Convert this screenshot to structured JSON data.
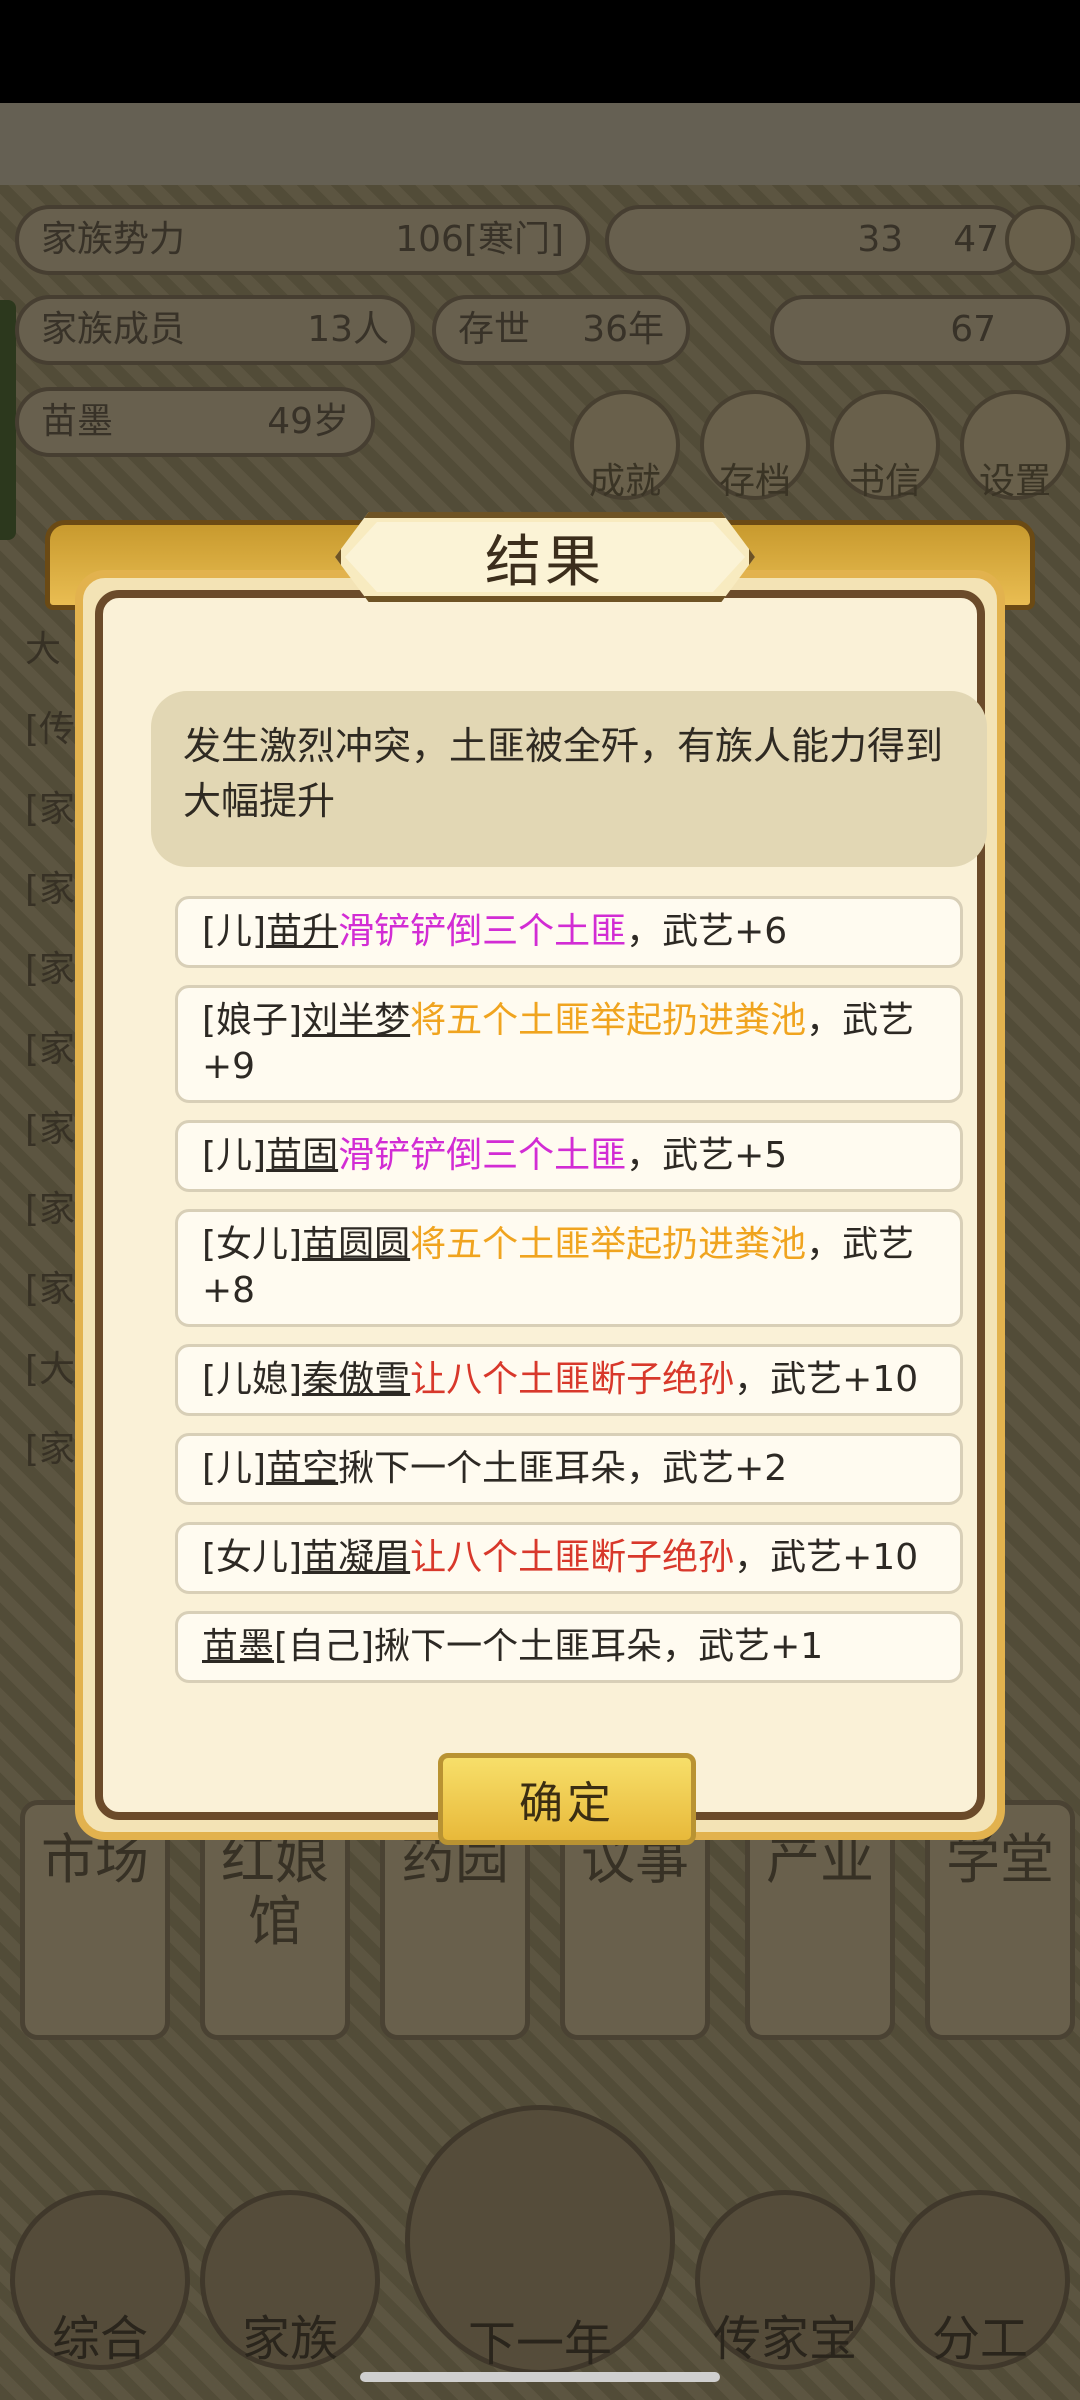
{
  "header": {
    "family_power_label": "家族势力",
    "family_power_value": "106[寒门]",
    "currency_silver": "33",
    "currency_coin": "47",
    "members_label": "家族成员",
    "members_value": "13人",
    "alive_label": "存世",
    "alive_value": "36年",
    "gold_value": "67",
    "char_name": "苗墨",
    "char_age": "49岁"
  },
  "top_buttons": [
    "成就",
    "存档",
    "书信",
    "设置"
  ],
  "side_list": [
    "大",
    "[传",
    "[家",
    "[家",
    "[家",
    "[家",
    "[家",
    "[家",
    "[家",
    "[大",
    "[家"
  ],
  "menu": [
    "市场",
    "红娘馆",
    "药园",
    "议事",
    "产业",
    "学堂"
  ],
  "bottom_nav": [
    "综合",
    "家族",
    "下一年",
    "传家宝",
    "分工"
  ],
  "dialog": {
    "title": "结果",
    "description": "发生激烈冲突，土匪被全歼，有族人能力得到大幅提升",
    "rows": [
      {
        "role": "[儿]",
        "name": "苗升",
        "action": "滑铲铲倒三个土匪",
        "action_color": "purple",
        "result": "，武艺+6"
      },
      {
        "role": "[娘子]",
        "name": "刘半梦",
        "action": "将五个土匪举起扔进粪池",
        "action_color": "orange",
        "result": "，武艺+9"
      },
      {
        "role": "[儿]",
        "name": "苗固",
        "action": "滑铲铲倒三个土匪",
        "action_color": "purple",
        "result": "，武艺+5"
      },
      {
        "role": "[女儿]",
        "name": "苗圆圆",
        "action": "将五个土匪举起扔进粪池",
        "action_color": "orange",
        "result": "，武艺+8"
      },
      {
        "role": "[儿媳]",
        "name": "秦傲雪",
        "action": "让八个土匪断子绝孙",
        "action_color": "red",
        "result": "，武艺+10"
      },
      {
        "role": "[儿]",
        "name": "苗空",
        "action": "揪下一个土匪耳朵",
        "action_color": "plain",
        "result": "，武艺+2"
      },
      {
        "role": "[女儿]",
        "name": "苗凝眉",
        "action": "让八个土匪断子绝孙",
        "action_color": "red",
        "result": "，武艺+10"
      },
      {
        "role": "[自己]",
        "name": "苗墨",
        "action": "揪下一个土匪耳朵",
        "action_color": "plain",
        "result": "，武艺+1",
        "name_first": true
      }
    ],
    "confirm_label": "确定"
  }
}
